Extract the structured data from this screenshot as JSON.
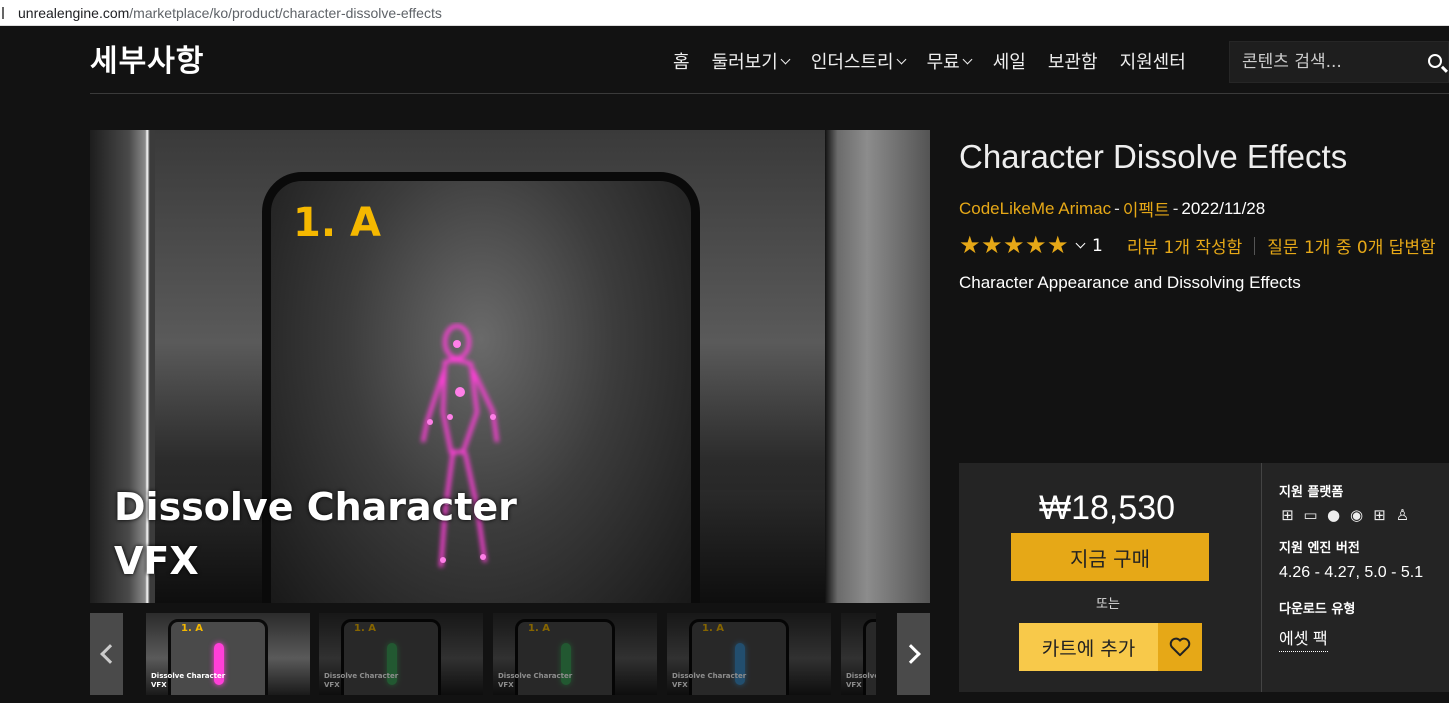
{
  "browser": {
    "url_domain": "unrealengine.com",
    "url_path": "/marketplace/ko/product/character-dissolve-effects"
  },
  "header": {
    "title": "세부사항",
    "nav": [
      {
        "label": "홈",
        "dropdown": false
      },
      {
        "label": "둘러보기",
        "dropdown": true
      },
      {
        "label": "인더스트리",
        "dropdown": true
      },
      {
        "label": "무료",
        "dropdown": true
      },
      {
        "label": "세일",
        "dropdown": false
      },
      {
        "label": "보관함",
        "dropdown": false
      },
      {
        "label": "지원센터",
        "dropdown": false
      }
    ],
    "search_placeholder": "콘텐츠 검색..."
  },
  "gallery": {
    "main_label": "1. A",
    "main_caption_line1": "Dissolve Character",
    "main_caption_line2": "VFX",
    "thumbnails": [
      {
        "label": "1. A",
        "caption1": "Dissolve Character",
        "caption2": "VFX",
        "figure_color": "#ff3fd8",
        "active": true
      },
      {
        "label": "1. A",
        "caption1": "Dissolve Character",
        "caption2": "VFX",
        "figure_color": "#3fa05a",
        "active": false
      },
      {
        "label": "1. A",
        "caption1": "Dissolve Character",
        "caption2": "VFX",
        "figure_color": "#3fa05a",
        "active": false
      },
      {
        "label": "1. A",
        "caption1": "Dissolve Character",
        "caption2": "VFX",
        "figure_color": "#3f8fc8",
        "active": false
      },
      {
        "label": "",
        "caption1": "Dissolve",
        "caption2": "VFX",
        "figure_color": "#555555",
        "active": false
      }
    ]
  },
  "product": {
    "title": "Character Dissolve Effects",
    "seller": "CodeLikeMe Arimac",
    "category": "이펙트",
    "date": "2022/11/28",
    "rating_stars": 5,
    "rating_count": "1",
    "review_link": "리뷰 1개 작성함",
    "question_link": "질문 1개 중 0개 답변함",
    "short_description": "Character Appearance and Dissolving Effects"
  },
  "purchase": {
    "price": "₩18,530",
    "buy_now": "지금 구매",
    "or": "또는",
    "add_to_cart": "카트에 추가"
  },
  "specs": {
    "platforms_label": "지원 플랫폼",
    "platform_icons": [
      "windows-icon",
      "laptop-icon",
      "apple-icon",
      "eye-icon",
      "windows-icon",
      "linux-icon"
    ],
    "engine_label": "지원 엔진 버전",
    "engine_versions": "4.26 - 4.27, 5.0 - 5.1",
    "download_label": "다운로드 유형",
    "download_type": "에셋 팩"
  },
  "colors": {
    "accent_gold": "#e6a817",
    "cart_yellow": "#f8c94a",
    "page_bg": "#121212",
    "box_bg": "#242424"
  }
}
